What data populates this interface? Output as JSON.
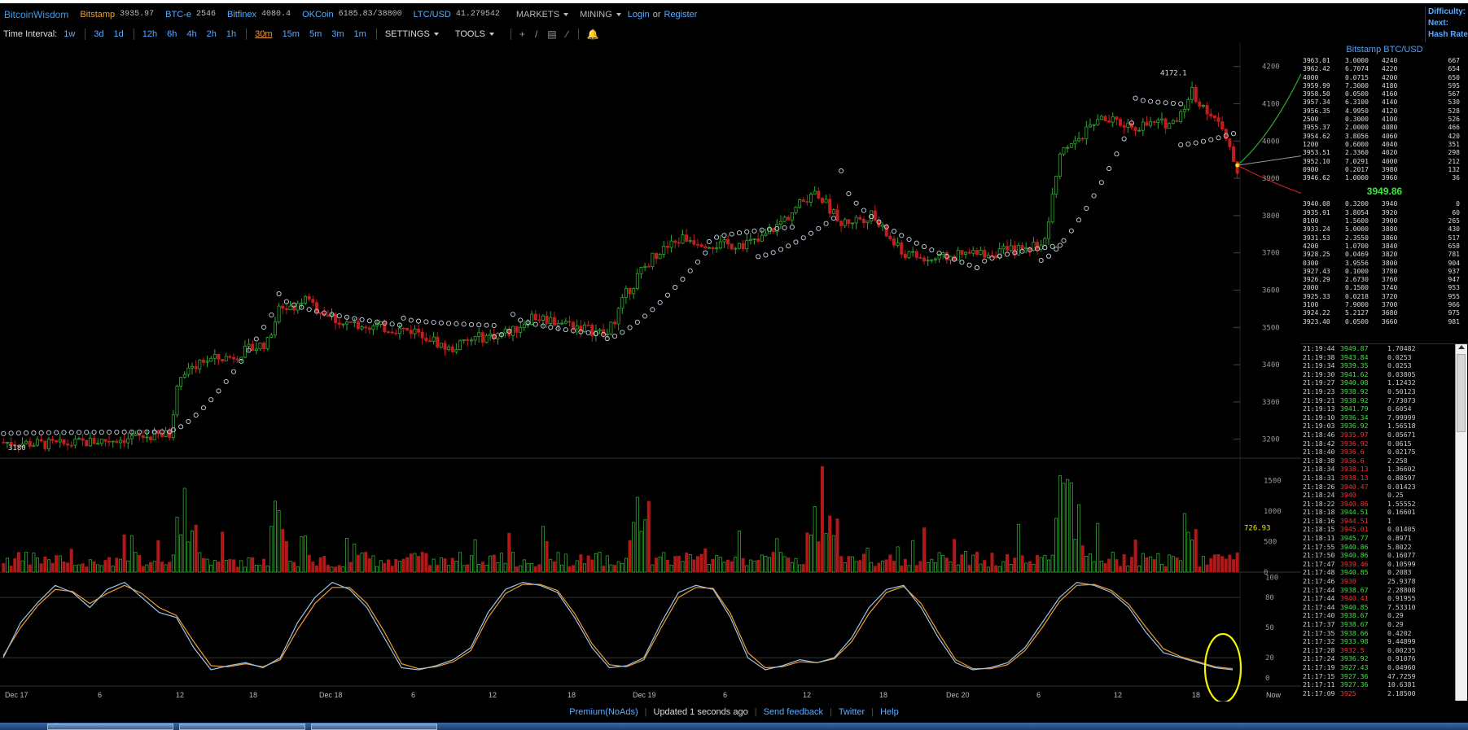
{
  "header": {
    "brand": "BitcoinWisdom",
    "exchanges": [
      {
        "name": "Bitstamp",
        "price": "3935.97"
      },
      {
        "name": "BTC-e",
        "price": "2546"
      },
      {
        "name": "Bitfinex",
        "price": "4080.4"
      },
      {
        "name": "OKCoin",
        "price": "6185.83/38800"
      },
      {
        "name": "LTC/USD",
        "price": "41.279542"
      }
    ],
    "markets_label": "MARKETS",
    "mining_label": "MINING",
    "login_label": "Login",
    "or_label": "or",
    "register_label": "Register",
    "right_info": [
      "Difficulty:",
      "Next:",
      "Hash Rate"
    ]
  },
  "toolbar": {
    "time_interval_label": "Time Interval:",
    "intervals_group1": [
      "1w",
      "3d",
      "1d"
    ],
    "intervals_group2": [
      "12h",
      "6h",
      "4h",
      "2h",
      "1h"
    ],
    "intervals_group3": [
      "30m",
      "15m",
      "5m",
      "3m",
      "1m"
    ],
    "active_interval": "30m",
    "settings_label": "SETTINGS",
    "tools_label": "TOOLS"
  },
  "chart_data": {
    "type": "candlestick",
    "pair": "Bitstamp BTC/USD",
    "price_axis": {
      "ticks": [
        3200,
        3300,
        3400,
        3500,
        3600,
        3700,
        3800,
        3900,
        4000,
        4100,
        4200
      ],
      "ylim": [
        3160,
        4230
      ]
    },
    "volume_axis": {
      "ticks": [
        0,
        500,
        1000,
        1500
      ],
      "ylim": [
        0,
        1800
      ]
    },
    "stoch_axis": {
      "ticks": [
        0,
        20,
        50,
        80,
        100
      ],
      "ylim": [
        -5,
        102
      ]
    },
    "x_labels": [
      "Dec 17",
      "6",
      "12",
      "18",
      "Dec 18",
      "6",
      "12",
      "18",
      "Dec 19",
      "6",
      "12",
      "18",
      "Dec 20",
      "6",
      "12",
      "18",
      "Now"
    ],
    "annotations": {
      "high_label": "4172.1",
      "low_label": "3180",
      "volume_label": "726.93"
    },
    "price_path": [
      [
        0,
        3192
      ],
      [
        15,
        3185
      ],
      [
        30,
        3200
      ],
      [
        44,
        3212
      ],
      [
        46,
        3345
      ],
      [
        52,
        3410
      ],
      [
        60,
        3420
      ],
      [
        70,
        3460
      ],
      [
        73,
        3550
      ],
      [
        80,
        3570
      ],
      [
        90,
        3510
      ],
      [
        100,
        3500
      ],
      [
        110,
        3490
      ],
      [
        118,
        3440
      ],
      [
        125,
        3470
      ],
      [
        135,
        3490
      ],
      [
        140,
        3530
      ],
      [
        150,
        3510
      ],
      [
        160,
        3480
      ],
      [
        165,
        3590
      ],
      [
        172,
        3690
      ],
      [
        180,
        3740
      ],
      [
        190,
        3720
      ],
      [
        200,
        3730
      ],
      [
        208,
        3800
      ],
      [
        215,
        3870
      ],
      [
        222,
        3780
      ],
      [
        230,
        3800
      ],
      [
        238,
        3700
      ],
      [
        245,
        3680
      ],
      [
        255,
        3695
      ],
      [
        262,
        3700
      ],
      [
        270,
        3710
      ],
      [
        276,
        3730
      ],
      [
        280,
        3960
      ],
      [
        290,
        4060
      ],
      [
        300,
        4040
      ],
      [
        310,
        4050
      ],
      [
        315,
        4130
      ],
      [
        322,
        4050
      ],
      [
        327,
        3920
      ]
    ],
    "sar_segments": [
      {
        "from": 0,
        "to": 44,
        "start": 3215,
        "end": 3220,
        "side": "above"
      },
      {
        "from": 45,
        "to": 72,
        "start": 3225,
        "end": 3550,
        "side": "below"
      },
      {
        "from": 73,
        "to": 106,
        "start": 3590,
        "end": 3505,
        "side": "above"
      },
      {
        "from": 106,
        "to": 130,
        "start": 3525,
        "end": 3505,
        "side": "above"
      },
      {
        "from": 130,
        "to": 134,
        "start": 3475,
        "end": 3490,
        "side": "below"
      },
      {
        "from": 135,
        "to": 160,
        "start": 3535,
        "end": 3480,
        "side": "above"
      },
      {
        "from": 160,
        "to": 186,
        "start": 3470,
        "end": 3700,
        "side": "below"
      },
      {
        "from": 187,
        "to": 210,
        "start": 3730,
        "end": 3770,
        "side": "above"
      },
      {
        "from": 200,
        "to": 221,
        "start": 3690,
        "end": 3800,
        "side": "below"
      },
      {
        "from": 222,
        "to": 258,
        "start": 3920,
        "end": 3660,
        "side": "above"
      },
      {
        "from": 258,
        "to": 280,
        "start": 3660,
        "end": 3720,
        "side": "above"
      },
      {
        "from": 275,
        "to": 300,
        "start": 3680,
        "end": 4070,
        "side": "below"
      },
      {
        "from": 300,
        "to": 312,
        "start": 4115,
        "end": 4100,
        "side": "above"
      },
      {
        "from": 312,
        "to": 326,
        "start": 3990,
        "end": 4020,
        "side": "below"
      }
    ],
    "stoch_k": [
      20,
      55,
      75,
      92,
      85,
      70,
      88,
      95,
      80,
      65,
      60,
      30,
      8,
      12,
      15,
      10,
      20,
      55,
      80,
      95,
      88,
      70,
      40,
      10,
      8,
      12,
      18,
      30,
      65,
      88,
      95,
      92,
      85,
      60,
      30,
      10,
      12,
      20,
      55,
      85,
      92,
      88,
      60,
      20,
      8,
      12,
      18,
      15,
      20,
      40,
      70,
      88,
      92,
      70,
      40,
      15,
      8,
      10,
      15,
      30,
      55,
      80,
      95,
      92,
      85,
      70,
      45,
      25,
      20,
      15,
      10,
      8
    ],
    "stoch_d": [
      22,
      50,
      72,
      88,
      86,
      74,
      84,
      92,
      84,
      70,
      62,
      36,
      12,
      11,
      14,
      11,
      18,
      48,
      74,
      90,
      90,
      74,
      46,
      14,
      9,
      11,
      16,
      27,
      60,
      84,
      93,
      93,
      87,
      64,
      34,
      13,
      11,
      18,
      50,
      80,
      90,
      89,
      64,
      25,
      10,
      11,
      16,
      15,
      19,
      36,
      64,
      85,
      91,
      74,
      45,
      18,
      9,
      9,
      13,
      27,
      50,
      76,
      92,
      93,
      87,
      73,
      50,
      29,
      21,
      16,
      11,
      9
    ],
    "order_book_asks": [
      [
        "3963.01",
        "3.0000",
        "4240",
        "667"
      ],
      [
        "3962.42",
        "6.7074",
        "4220",
        "654"
      ],
      [
        "4000",
        "0.0715",
        "4200",
        "650"
      ],
      [
        "3959.99",
        "7.3000",
        "4180",
        "595"
      ],
      [
        "3958.50",
        "0.0500",
        "4160",
        "567"
      ],
      [
        "3957.34",
        "6.3100",
        "4140",
        "530"
      ],
      [
        "3956.35",
        "4.9950",
        "4120",
        "528"
      ],
      [
        "2500",
        "0.3000",
        "4100",
        "526"
      ],
      [
        "3955.37",
        "2.0000",
        "4080",
        "466"
      ],
      [
        "3954.62",
        "3.8056",
        "4060",
        "420"
      ],
      [
        "1200",
        "0.6000",
        "4040",
        "351"
      ],
      [
        "3953.51",
        "2.3360",
        "4020",
        "298"
      ],
      [
        "3952.10",
        "7.0291",
        "4000",
        "212"
      ],
      [
        "0900",
        "0.2017",
        "3980",
        "132"
      ],
      [
        "3946.62",
        "1.0000",
        "3960",
        "36"
      ]
    ],
    "order_book_mid": "3949.86",
    "order_book_bids": [
      [
        "3940.08",
        "0.3200",
        "3940",
        "0"
      ],
      [
        "3935.91",
        "3.8054",
        "3920",
        "60"
      ],
      [
        "8100",
        "1.5600",
        "3900",
        "265"
      ],
      [
        "3933.24",
        "5.0000",
        "3880",
        "430"
      ],
      [
        "3931.53",
        "2.3550",
        "3860",
        "517"
      ],
      [
        "4200",
        "1.0700",
        "3840",
        "658"
      ],
      [
        "3928.25",
        "0.0469",
        "3820",
        "781"
      ],
      [
        "0300",
        "3.9556",
        "3800",
        "904"
      ],
      [
        "3927.43",
        "0.1000",
        "3780",
        "937"
      ],
      [
        "3926.29",
        "2.6730",
        "3760",
        "947"
      ],
      [
        "2000",
        "0.1500",
        "3740",
        "953"
      ],
      [
        "3925.33",
        "0.0218",
        "3720",
        "955"
      ],
      [
        "3100",
        "7.9000",
        "3700",
        "966"
      ],
      [
        "3924.22",
        "5.2127",
        "3680",
        "975"
      ],
      [
        "3923.40",
        "0.0500",
        "3660",
        "981"
      ]
    ],
    "trades": [
      [
        "21:19:44",
        "3949.87",
        "1.70482",
        "buy"
      ],
      [
        "21:19:38",
        "3943.84",
        "0.0253",
        "buy"
      ],
      [
        "21:19:34",
        "3939.35",
        "0.0253",
        "buy"
      ],
      [
        "21:19:30",
        "3941.62",
        "0.03805",
        "buy"
      ],
      [
        "21:19:27",
        "3940.08",
        "1.12432",
        "buy"
      ],
      [
        "21:19:23",
        "3938.92",
        "0.50123",
        "buy"
      ],
      [
        "21:19:21",
        "3938.92",
        "7.73073",
        "buy"
      ],
      [
        "21:19:13",
        "3941.79",
        "0.6054",
        "buy"
      ],
      [
        "21:19:10",
        "3936.34",
        "7.99999",
        "buy"
      ],
      [
        "21:19:03",
        "3936.92",
        "1.56518",
        "buy"
      ],
      [
        "21:18:46",
        "3935.97",
        "0.05671",
        "sell"
      ],
      [
        "21:18:42",
        "3936.92",
        "0.0615",
        "sell"
      ],
      [
        "21:18:40",
        "3936.6",
        "0.02175",
        "sell"
      ],
      [
        "21:18:38",
        "3936.6",
        "2.258",
        "sell"
      ],
      [
        "21:18:34",
        "3938.13",
        "1.36602",
        "sell"
      ],
      [
        "21:18:31",
        "3938.13",
        "0.80597",
        "sell"
      ],
      [
        "21:18:26",
        "3940.47",
        "0.01423",
        "sell"
      ],
      [
        "21:18:24",
        "3940",
        "0.25",
        "sell"
      ],
      [
        "21:18:22",
        "3940.86",
        "1.55552",
        "sell"
      ],
      [
        "21:18:18",
        "3944.51",
        "0.16601",
        "buy"
      ],
      [
        "21:18:16",
        "3944.51",
        "1",
        "sell"
      ],
      [
        "21:18:15",
        "3945.01",
        "0.01405",
        "sell"
      ],
      [
        "21:18:11",
        "3945.77",
        "0.8971",
        "buy"
      ],
      [
        "21:17:55",
        "3940.86",
        "5.8022",
        "buy"
      ],
      [
        "21:17:50",
        "3940.86",
        "0.16077",
        "buy"
      ],
      [
        "21:17:47",
        "3939.46",
        "0.10599",
        "sell"
      ],
      [
        "21:17:48",
        "3940.85",
        "0.2083",
        "buy"
      ],
      [
        "21:17:46",
        "3930",
        "25.9378",
        "sell"
      ],
      [
        "21:17:44",
        "3938.67",
        "2.28808",
        "buy"
      ],
      [
        "21:17:44",
        "3940.41",
        "0.91955",
        "sell"
      ],
      [
        "21:17:44",
        "3940.85",
        "7.53310",
        "buy"
      ],
      [
        "21:17:40",
        "3938.67",
        "0.29",
        "buy"
      ],
      [
        "21:17:37",
        "3938.67",
        "0.29",
        "buy"
      ],
      [
        "21:17:35",
        "3938.66",
        "0.4202",
        "buy"
      ],
      [
        "21:17:32",
        "3933.98",
        "9.44899",
        "buy"
      ],
      [
        "21:17:28",
        "3932.5",
        "0.00235",
        "sell"
      ],
      [
        "21:17:24",
        "3936.92",
        "0.91076",
        "buy"
      ],
      [
        "21:17:19",
        "3927.43",
        "0.04960",
        "buy"
      ],
      [
        "21:17:15",
        "3927.36",
        "47.7259",
        "buy"
      ],
      [
        "21:17:11",
        "3927.36",
        "10.6381",
        "buy"
      ],
      [
        "21:17:09",
        "3925",
        "2.18500",
        "sell"
      ]
    ]
  },
  "footer": {
    "premium": "Premium(NoAds)",
    "updated": "Updated 1 seconds ago",
    "feedback": "Send feedback",
    "twitter": "Twitter",
    "help": "Help"
  }
}
